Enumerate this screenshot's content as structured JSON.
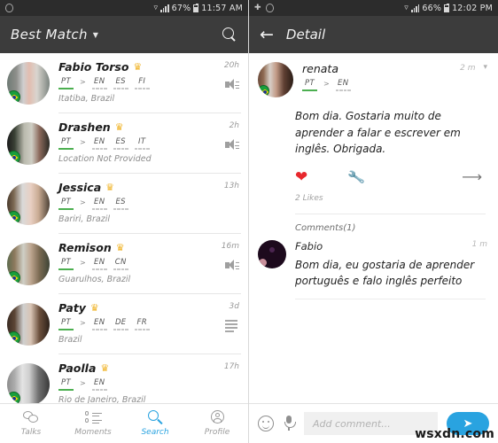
{
  "left": {
    "status_bar": {
      "icons": [
        "heart-icon",
        "wifi-icon",
        "signal-icon"
      ],
      "battery": "67%",
      "time": "11:57 AM"
    },
    "app_bar": {
      "title": "Best Match",
      "caret": "▼",
      "search_icon": "search-icon"
    },
    "rows": [
      {
        "name": "Fabio Torso",
        "crown": "♛",
        "time": "20h",
        "native": "PT",
        "learning": [
          "EN",
          "ES",
          "FI"
        ],
        "location": "Itatiba, Brazil",
        "icon": "speaker-icon"
      },
      {
        "name": "Drashen",
        "crown": "♛",
        "time": "2h",
        "native": "PT",
        "learning": [
          "EN",
          "ES",
          "IT"
        ],
        "location": "Location Not Provided",
        "icon": "speaker-icon"
      },
      {
        "name": "Jessica",
        "crown": "♛",
        "time": "13h",
        "native": "PT",
        "learning": [
          "EN",
          "ES"
        ],
        "location": "Bariri, Brazil",
        "icon": "none"
      },
      {
        "name": "Remison",
        "crown": "♛",
        "time": "16m",
        "native": "PT",
        "learning": [
          "EN",
          "CN"
        ],
        "location": "Guarulhos, Brazil",
        "icon": "speaker-icon"
      },
      {
        "name": "Paty",
        "crown": "♛",
        "time": "3d",
        "native": "PT",
        "learning": [
          "EN",
          "DE",
          "FR"
        ],
        "location": "Brazil",
        "icon": "lines-icon"
      },
      {
        "name": "Paolla",
        "crown": "♛",
        "time": "17h",
        "native": "PT",
        "learning": [
          "EN"
        ],
        "location": "Rio de Janeiro, Brazil",
        "icon": "none"
      }
    ],
    "nav": [
      {
        "label": "Talks",
        "icon": "chat-bubbles-icon",
        "active": false
      },
      {
        "label": "Moments",
        "icon": "feed-list-icon",
        "active": false
      },
      {
        "label": "Search",
        "icon": "magnifier-icon",
        "active": true
      },
      {
        "label": "Profile",
        "icon": "person-icon",
        "active": false
      }
    ]
  },
  "right": {
    "status_bar": {
      "icons": [
        "cloud-icon",
        "heart-icon",
        "wifi-icon",
        "signal-icon"
      ],
      "battery": "66%",
      "time": "12:02 PM"
    },
    "app_bar": {
      "back_icon": "back-arrow-icon",
      "title": "Detail"
    },
    "post": {
      "author": "renata",
      "native": "PT",
      "learning": [
        "EN"
      ],
      "time": "2 m",
      "chevron": "⌄",
      "text": "Bom dia. Gostaria muito de aprender a falar e escrever em inglês. Obrigada.",
      "like_icon": "heart-icon",
      "tool_icon": "wrench-icon",
      "share_icon": "share-arrow-icon",
      "likes": "2 Likes"
    },
    "comments_header": "Comments(1)",
    "comments": [
      {
        "author": "Fabio",
        "time": "1 m",
        "text": "Bom dia, eu gostaria de aprender português e falo inglês perfeito"
      }
    ],
    "comment_bar": {
      "emoji_icon": "emoji-icon",
      "mic_icon": "microphone-icon",
      "placeholder": "Add comment...",
      "send_icon": "send-icon"
    },
    "watermark": "wsxdn.com"
  },
  "colors": {
    "accent": "#29a3e0",
    "heart": "#e8282d",
    "crown": "#f0b429",
    "native_bar": "#4caf50"
  }
}
